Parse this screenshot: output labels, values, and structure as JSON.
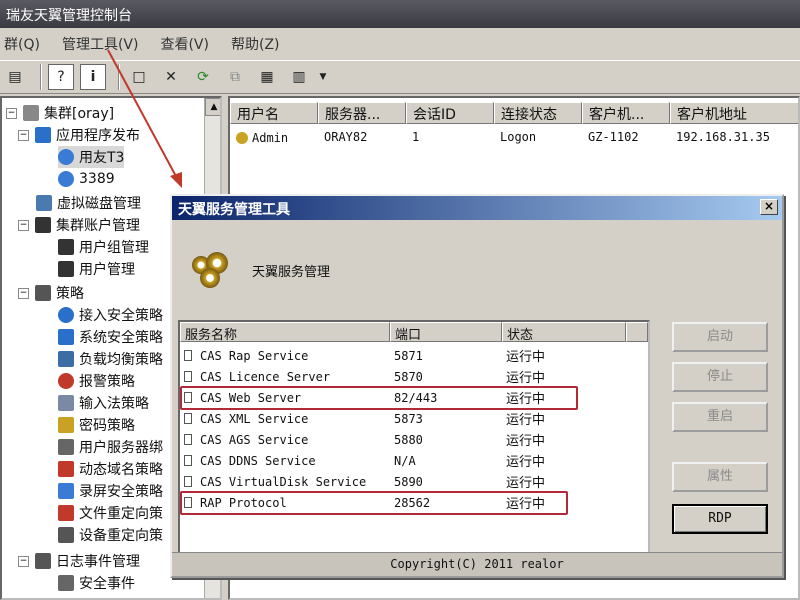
{
  "window": {
    "title": "瑞友天翼管理控制台"
  },
  "menu": [
    {
      "label": "群(Q)"
    },
    {
      "label": "管理工具(V)"
    },
    {
      "label": "查看(V)"
    },
    {
      "label": "帮助(Z)"
    }
  ],
  "tree": {
    "items": [
      {
        "label": "集群[oray]",
        "color": "#333"
      },
      {
        "label": "应用程序发布",
        "color": "#2a6fc9"
      },
      {
        "label": "用友T3",
        "color": "#3a7bd5"
      },
      {
        "label": "3389",
        "color": "#3a7bd5"
      },
      {
        "label": "虚拟磁盘管理",
        "color": "#4a7ab0"
      },
      {
        "label": "集群账户管理",
        "color": "#333"
      },
      {
        "label": "用户组管理",
        "color": "#333"
      },
      {
        "label": "用户管理",
        "color": "#333"
      },
      {
        "label": "策略",
        "color": "#555"
      },
      {
        "label": "接入安全策略",
        "color": "#2a6fc9"
      },
      {
        "label": "系统安全策略",
        "color": "#2a6fc9"
      },
      {
        "label": "负载均衡策略",
        "color": "#3c6ea5"
      },
      {
        "label": "报警策略",
        "color": "#c0392b"
      },
      {
        "label": "输入法策略",
        "color": "#7a8aa5"
      },
      {
        "label": "密码策略",
        "color": "#c9a224"
      },
      {
        "label": "用户服务器绑",
        "color": "#666"
      },
      {
        "label": "动态域名策略",
        "color": "#c0392b"
      },
      {
        "label": "录屏安全策略",
        "color": "#3a7bd5"
      },
      {
        "label": "文件重定向策",
        "color": "#c0392b"
      },
      {
        "label": "设备重定向策",
        "color": "#555"
      },
      {
        "label": "日志事件管理",
        "color": "#555"
      },
      {
        "label": "安全事件",
        "color": "#666"
      }
    ]
  },
  "list": {
    "columns": [
      "用户名",
      "服务器...",
      "会话ID",
      "连接状态",
      "客户机...",
      "客户机地址"
    ],
    "rows": [
      [
        "Admin",
        "ORAY82",
        "1",
        "Logon",
        "GZ-1102",
        "192.168.31.35"
      ]
    ]
  },
  "dialog": {
    "title": "天翼服务管理工具",
    "close": "×",
    "heading": "天翼服务管理",
    "columns": [
      "服务名称",
      "端口",
      "状态"
    ],
    "services": [
      {
        "name": "CAS Rap Service",
        "port": "5871",
        "status": "运行中"
      },
      {
        "name": "CAS Licence Server",
        "port": "5870",
        "status": "运行中"
      },
      {
        "name": "CAS Web Server",
        "port": "82/443",
        "status": "运行中"
      },
      {
        "name": "CAS XML Service",
        "port": "5873",
        "status": "运行中"
      },
      {
        "name": "CAS AGS Service",
        "port": "5880",
        "status": "运行中"
      },
      {
        "name": "CAS DDNS Service",
        "port": "N/A",
        "status": "运行中"
      },
      {
        "name": "CAS VirtualDisk Service",
        "port": "5890",
        "status": "运行中"
      },
      {
        "name": "RAP Protocol",
        "port": "28562",
        "status": "运行中"
      }
    ],
    "buttons": {
      "start": "启动",
      "stop": "停止",
      "restart": "重启",
      "properties": "属性",
      "rdp": "RDP"
    },
    "footer": "Copyright(C) 2011 realor"
  }
}
